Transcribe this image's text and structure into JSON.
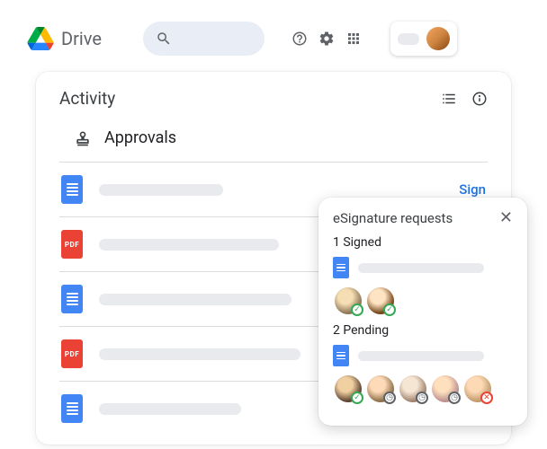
{
  "app": {
    "name": "Drive"
  },
  "activity": {
    "title": "Activity",
    "section": "Approvals",
    "sign_action": "Sign",
    "rows": [
      {
        "type": "docs",
        "placeholder_width": 138
      },
      {
        "type": "pdf",
        "placeholder_width": 200
      },
      {
        "type": "docs",
        "placeholder_width": 214
      },
      {
        "type": "pdf",
        "placeholder_width": 224
      },
      {
        "type": "docs",
        "placeholder_width": 158
      }
    ]
  },
  "esign": {
    "title": "eSignature requests",
    "status_signed": "1 Signed",
    "status_pending": "2 Pending",
    "signed_avatars": [
      {
        "cls": "a1",
        "status": "check"
      },
      {
        "cls": "a2",
        "status": "check"
      }
    ],
    "pending_avatars": [
      {
        "cls": "a3",
        "status": "check"
      },
      {
        "cls": "a4",
        "status": "clock"
      },
      {
        "cls": "a5",
        "status": "clock"
      },
      {
        "cls": "a6",
        "status": "clock"
      },
      {
        "cls": "a7",
        "status": "x"
      }
    ]
  },
  "icons": {
    "pdf_label": "PDF"
  }
}
